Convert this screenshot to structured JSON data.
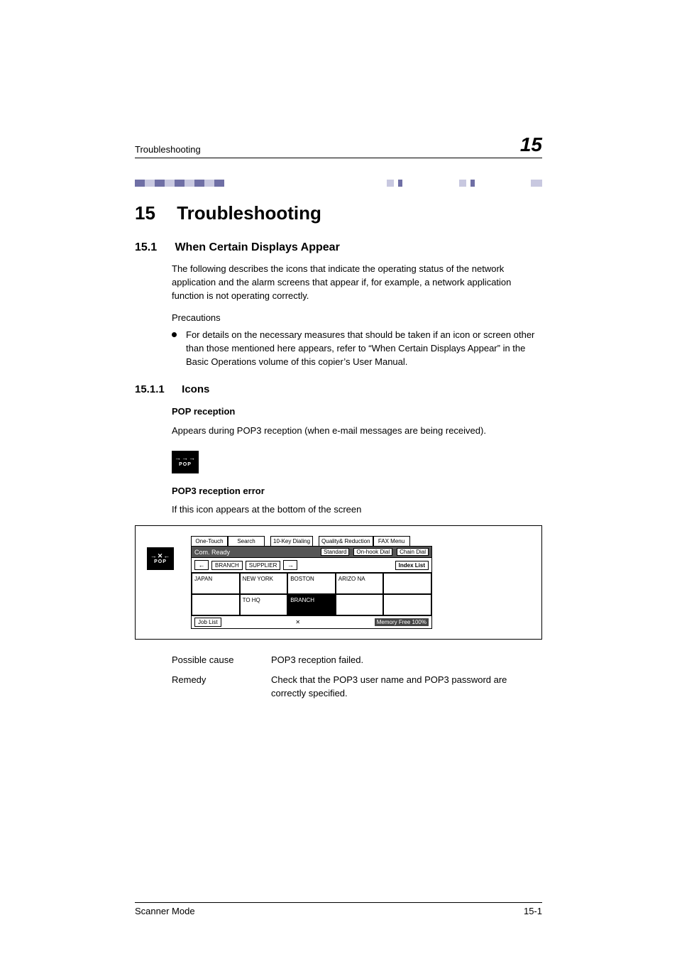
{
  "header": {
    "running_title": "Troubleshooting",
    "chapter_number_big": "15"
  },
  "chapter": {
    "number": "15",
    "title": "Troubleshooting"
  },
  "section": {
    "number": "15.1",
    "title": "When Certain Displays Appear",
    "intro": "The following describes the icons that indicate the operating status of the network application and the alarm screens that appear if, for example, a network application function is not operating correctly.",
    "precautions_label": "Precautions",
    "bullet1": "For details on the necessary measures that should be taken if an icon or screen other than those mentioned here appears, refer to “When Certain Displays Appear” in the Basic Operations volume of this copier’s User Manual."
  },
  "subsection": {
    "number": "15.1.1",
    "title": "Icons"
  },
  "pop_reception": {
    "heading": "POP reception",
    "text": "Appears during POP3 reception (when e-mail messages are being received)."
  },
  "pop_icon": {
    "arrows": "→→→",
    "label": "POP"
  },
  "pop_error_icon": {
    "arrows": "→✕←",
    "label": "POP"
  },
  "pop_error": {
    "heading": "POP3 reception error",
    "text": "If this icon appears at the bottom of the screen"
  },
  "fax_panel": {
    "tabs": [
      "One-Touch",
      "Search",
      "10-Key Dialing",
      "Quality& Reduction",
      "FAX Menu"
    ],
    "status": {
      "ready": "Com. Ready",
      "pills": [
        "Standard",
        "On-hook Dial",
        "Chain Dial"
      ]
    },
    "nav": {
      "left": "←",
      "group1": "BRANCH",
      "group2": "SUPPLIER",
      "right": "→",
      "index": "Index List"
    },
    "grid_row1": [
      "JAPAN",
      "NEW YORK",
      "BOSTON",
      "ARIZO NA",
      ""
    ],
    "grid_row2": [
      "",
      "TO HQ",
      "BRANCH",
      "",
      ""
    ],
    "footer": {
      "job_list": "Job List",
      "memory": "Memory Free 100%"
    }
  },
  "diagnosis": {
    "cause_label": "Possible cause",
    "cause_value": "POP3 reception failed.",
    "remedy_label": "Remedy",
    "remedy_value": "Check that the POP3 user name and POP3 password are correctly specified."
  },
  "footer": {
    "left": "Scanner Mode",
    "right": "15-1"
  }
}
